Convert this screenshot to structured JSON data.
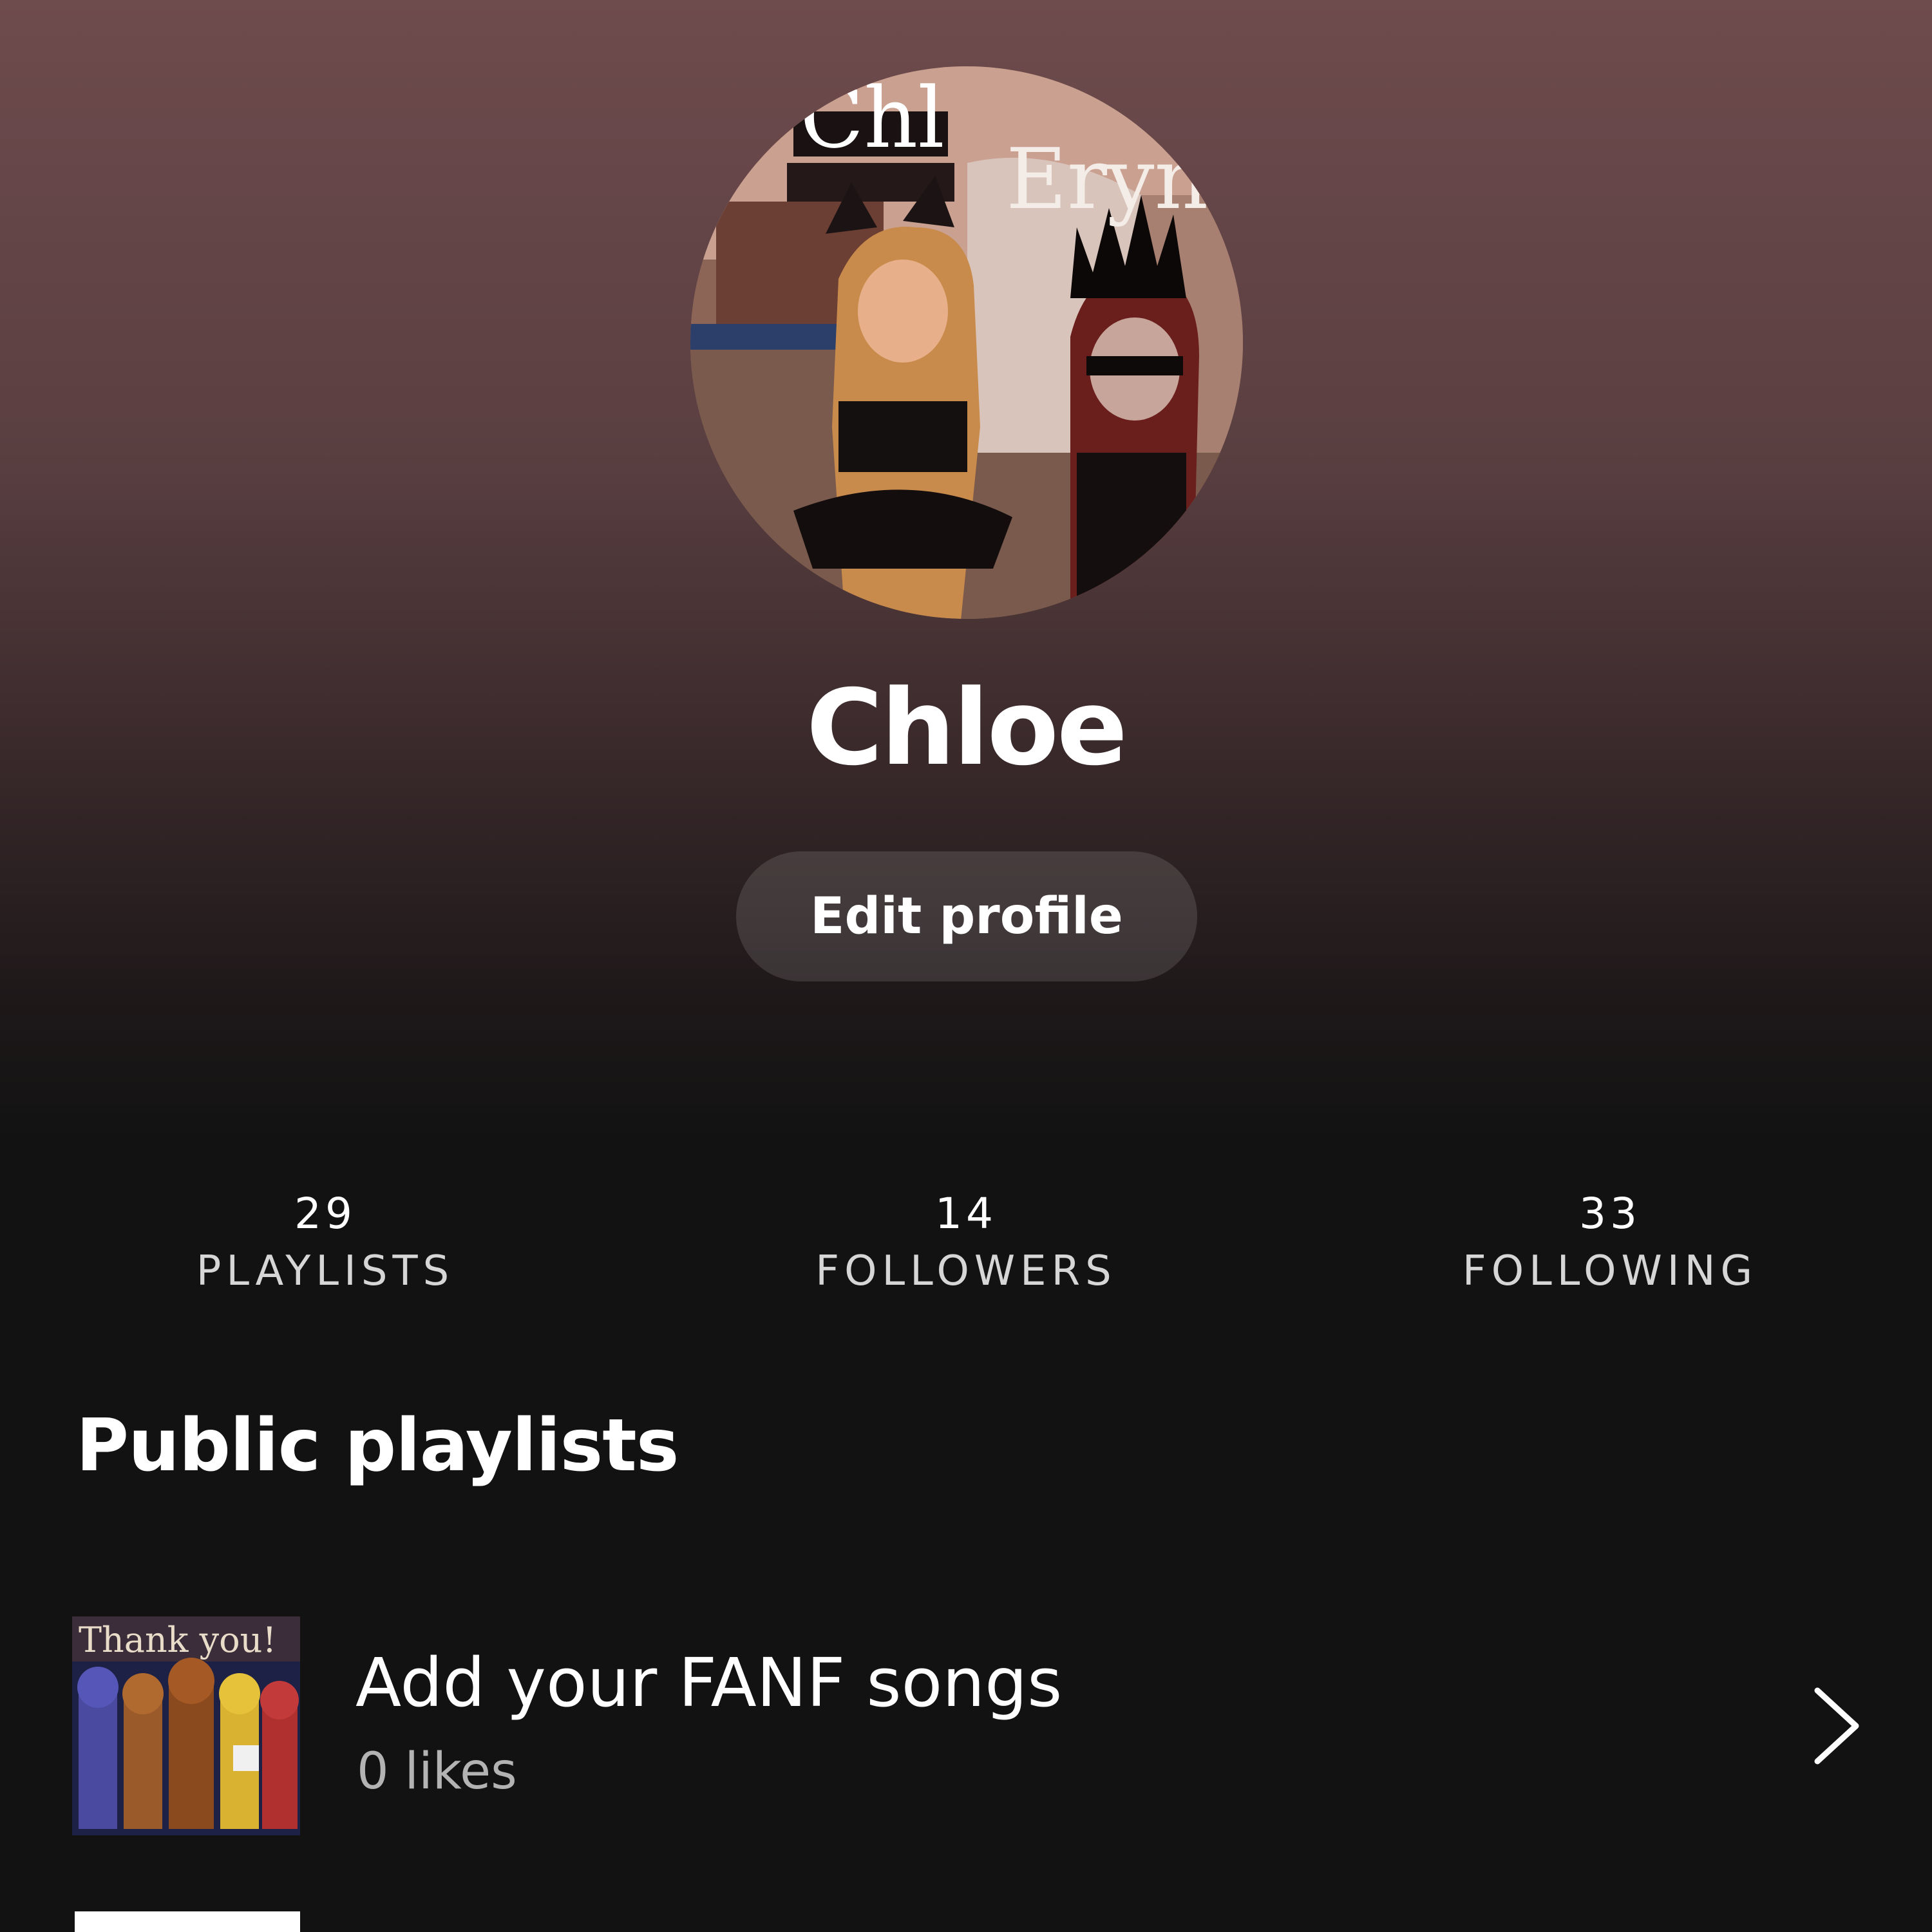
{
  "profile": {
    "name": "Chloe",
    "avatar_overlay_text": [
      "Chl",
      "Eryn"
    ],
    "edit_label": "Edit profile"
  },
  "stats": [
    {
      "count": "29",
      "label": "PLAYLISTS"
    },
    {
      "count": "14",
      "label": "FOLLOWERS"
    },
    {
      "count": "33",
      "label": "FOLLOWING"
    }
  ],
  "public_playlists": {
    "title": "Public playlists",
    "items": [
      {
        "title": "Add your FANF songs",
        "subtitle": "0 likes",
        "cover_text": "Thank you!",
        "icon": "chevron-right-icon"
      }
    ]
  },
  "colors": {
    "header_gradient_top": "#6e4b4d",
    "background": "#121212",
    "secondary_text": "#b3b3b3",
    "button_bg": "rgba(255,255,255,0.12)"
  }
}
